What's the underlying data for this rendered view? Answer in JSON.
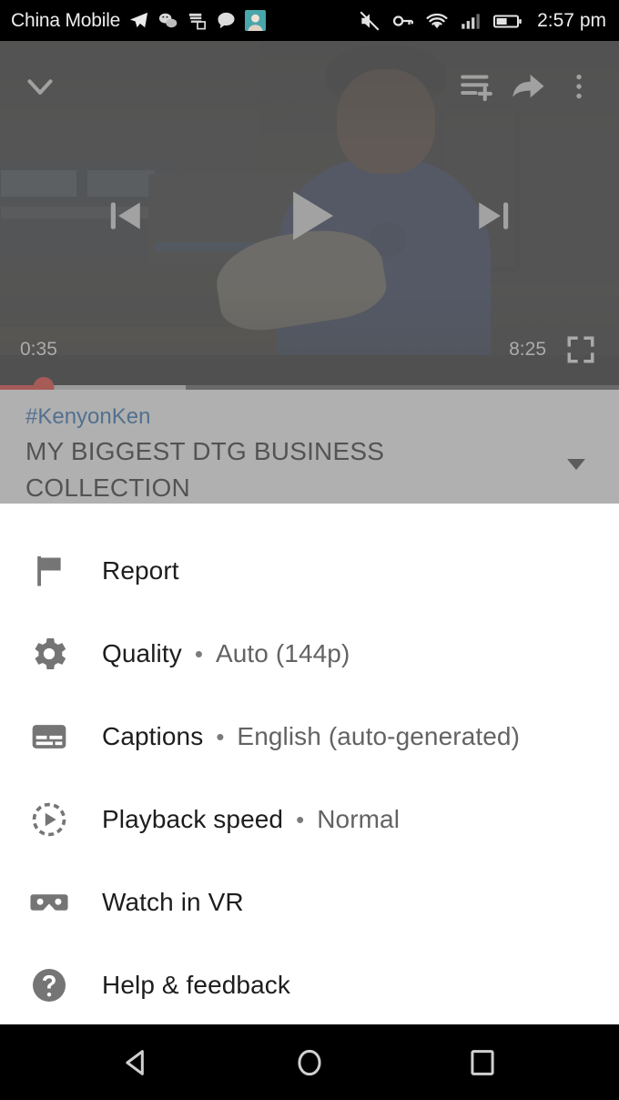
{
  "status_bar": {
    "carrier": "China Mobile",
    "time": "2:57 pm",
    "app_icons": [
      "telegram-icon",
      "wechat-icon",
      "stack-icon",
      "message-icon",
      "avatar-icon"
    ],
    "system_icons": [
      "mute-icon",
      "vpn-key-icon",
      "wifi-icon",
      "signal-icon",
      "battery-icon"
    ]
  },
  "player": {
    "current_time": "0:35",
    "duration": "8:25",
    "progress_percent": 7,
    "buffered_percent": 30,
    "accent_color": "#e52117",
    "controls": {
      "collapse": "chevron-down-icon",
      "add_to_queue": "add-to-queue-icon",
      "share": "share-icon",
      "more": "more-vertical-icon",
      "previous": "previous-icon",
      "play": "play-icon",
      "next": "next-icon",
      "fullscreen": "fullscreen-icon"
    }
  },
  "video_meta": {
    "hashtag": "#KenyonKen",
    "title": "MY BIGGEST DTG BUSINESS COLLECTION",
    "expand_icon": "expand-description-icon"
  },
  "sheet": {
    "items": [
      {
        "icon": "flag-icon",
        "label": "Report",
        "value": ""
      },
      {
        "icon": "gear-icon",
        "label": "Quality",
        "value": "Auto (144p)"
      },
      {
        "icon": "captions-icon",
        "label": "Captions",
        "value": "English (auto-generated)"
      },
      {
        "icon": "playback-speed-icon",
        "label": "Playback speed",
        "value": "Normal"
      },
      {
        "icon": "vr-cardboard-icon",
        "label": "Watch in VR",
        "value": ""
      },
      {
        "icon": "help-circle-icon",
        "label": "Help & feedback",
        "value": ""
      }
    ],
    "separator": "•"
  },
  "navbar": {
    "back": "back-triangle-icon",
    "home": "home-circle-icon",
    "recents": "recents-square-icon"
  }
}
